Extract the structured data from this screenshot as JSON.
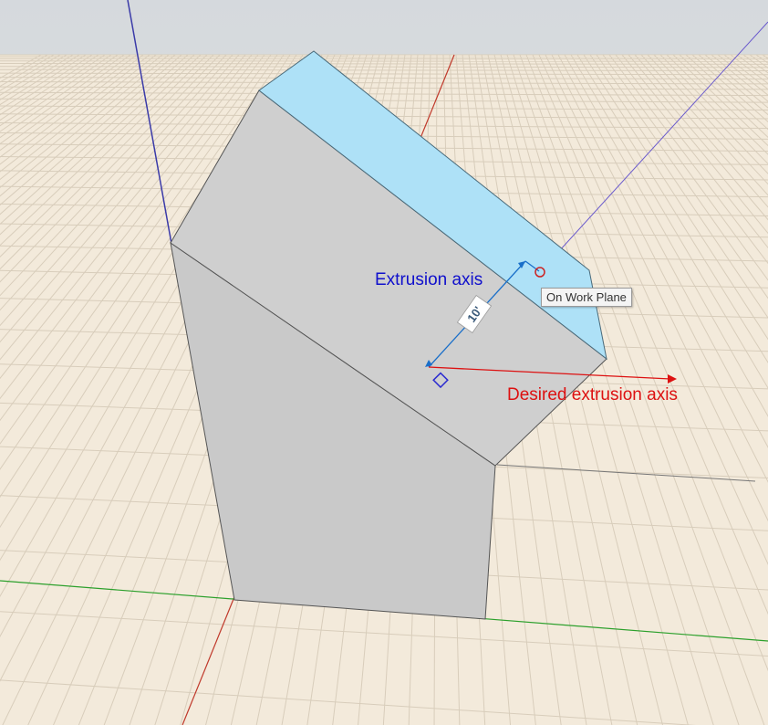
{
  "viewport": {
    "labels": {
      "extrusion_axis": "Extrusion axis",
      "desired_extrusion_axis": "Desired extrusion axis"
    },
    "dimension": {
      "value": "10'"
    },
    "tooltip": {
      "text": "On Work Plane"
    }
  },
  "colors": {
    "sky": "#d9dde1",
    "grid_floor": "#f3eadb",
    "grid_line": "#dcd2c2",
    "solid_face": "#cfcfcf",
    "top_face": "#aee1f7",
    "extrusion_axis": "#1a6fc9",
    "desired_axis": "#dd1111",
    "x_axis": "#c0392b",
    "y_axis": "#2ca02c",
    "z_axis": "#3a3aa8"
  }
}
